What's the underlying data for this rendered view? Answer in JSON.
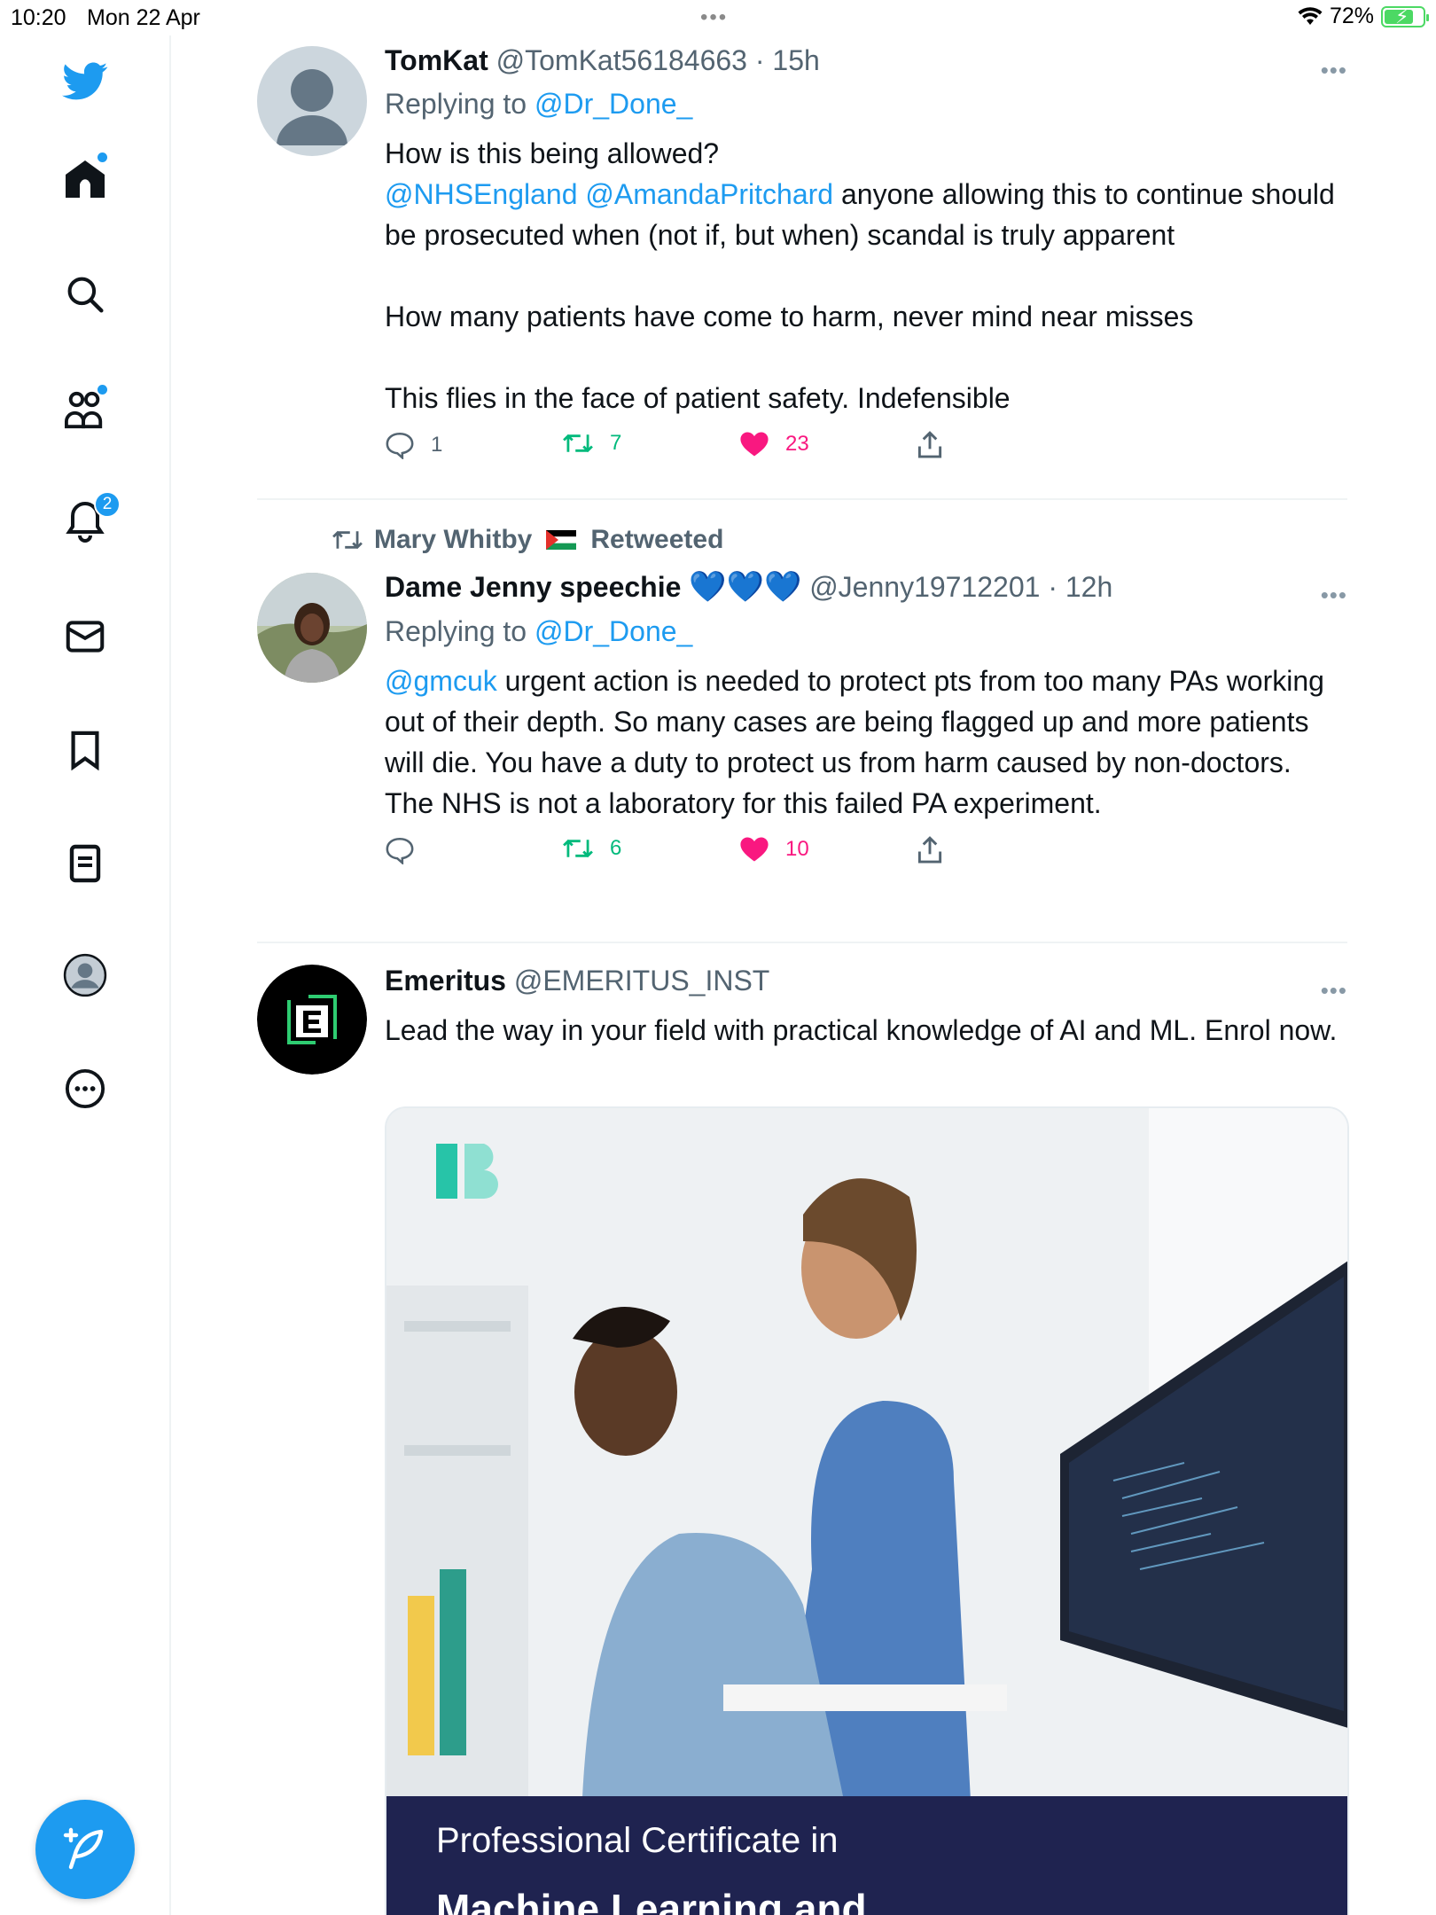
{
  "status_bar": {
    "time": "10:20",
    "date": "Mon 22 Apr",
    "battery": "72%"
  },
  "sidebar": {
    "notification_count": "2"
  },
  "tweets": [
    {
      "name": "TomKat",
      "handle": "@TomKat56184663",
      "time": "· 15h",
      "replying_label": "Replying to",
      "replying_to": "@Dr_Done_",
      "line1": "How is this being allowed?",
      "mention1": "@NHSEngland",
      "mention2": "@AmandaPritchard",
      "line2_rest": "anyone allowing this to continue should be prosecuted when (not if, but when) scandal is truly apparent",
      "line3": "How many patients have come to harm, never mind near misses",
      "line4": "This flies in the face of patient safety. Indefensible",
      "replies": "1",
      "retweets": "7",
      "likes": "23"
    },
    {
      "retweeted_by": "Mary Whitby",
      "retweeted_label": "Retweeted",
      "name": "Dame Jenny speechie",
      "hearts": "💙💙💙",
      "handle": "@Jenny19712201",
      "time": "· 12h",
      "replying_label": "Replying to",
      "replying_to": "@Dr_Done_",
      "mention": "@gmcuk",
      "text_rest": "urgent action is needed  to protect pts from too many PAs working out of their depth. So many cases are being flagged up and more patients will die. You have a duty to protect us from harm caused by non-doctors. The NHS is not a laboratory for this failed PA experiment.",
      "replies": "",
      "retweets": "6",
      "likes": "10"
    },
    {
      "name": "Emeritus",
      "handle": "@EMERITUS_INST",
      "text": "Lead the way in your field with practical knowledge of AI and ML. Enrol now.",
      "ad_banner_line1": "Professional Certificate in",
      "ad_banner_line2": "Machine Learning and"
    }
  ],
  "colors": {
    "accent": "#1d9bf0",
    "retweet": "#00ba7c",
    "like": "#f91880",
    "muted": "#536471"
  }
}
